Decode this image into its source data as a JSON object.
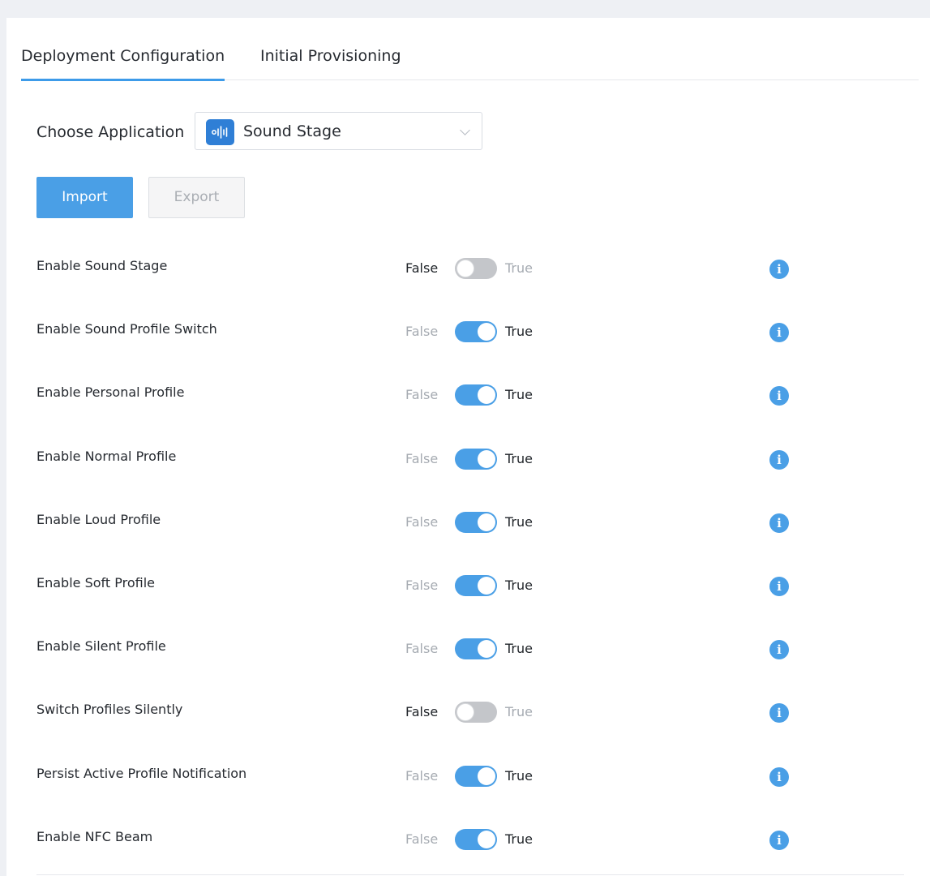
{
  "tabs": [
    {
      "label": "Deployment Configuration",
      "active": true
    },
    {
      "label": "Initial Provisioning",
      "active": false
    }
  ],
  "app_chooser": {
    "label": "Choose Application",
    "selected": "Sound Stage",
    "icon": "sound-wave-icon"
  },
  "buttons": {
    "import": "Import",
    "export": "Export"
  },
  "toggle_labels": {
    "false": "False",
    "true": "True"
  },
  "settings": [
    {
      "label": "Enable Sound Stage",
      "value": false
    },
    {
      "label": "Enable Sound Profile Switch",
      "value": true
    },
    {
      "label": "Enable Personal Profile",
      "value": true
    },
    {
      "label": "Enable Normal Profile",
      "value": true
    },
    {
      "label": "Enable Loud Profile",
      "value": true
    },
    {
      "label": "Enable Soft Profile",
      "value": true
    },
    {
      "label": "Enable Silent Profile",
      "value": true
    },
    {
      "label": "Switch Profiles Silently",
      "value": false
    },
    {
      "label": "Persist Active Profile Notification",
      "value": true
    },
    {
      "label": "Enable NFC Beam",
      "value": true
    }
  ],
  "colors": {
    "accent": "#4a9fe6",
    "toggle_off": "#c4c6ca",
    "app_icon_bg": "#2f7fd6"
  }
}
